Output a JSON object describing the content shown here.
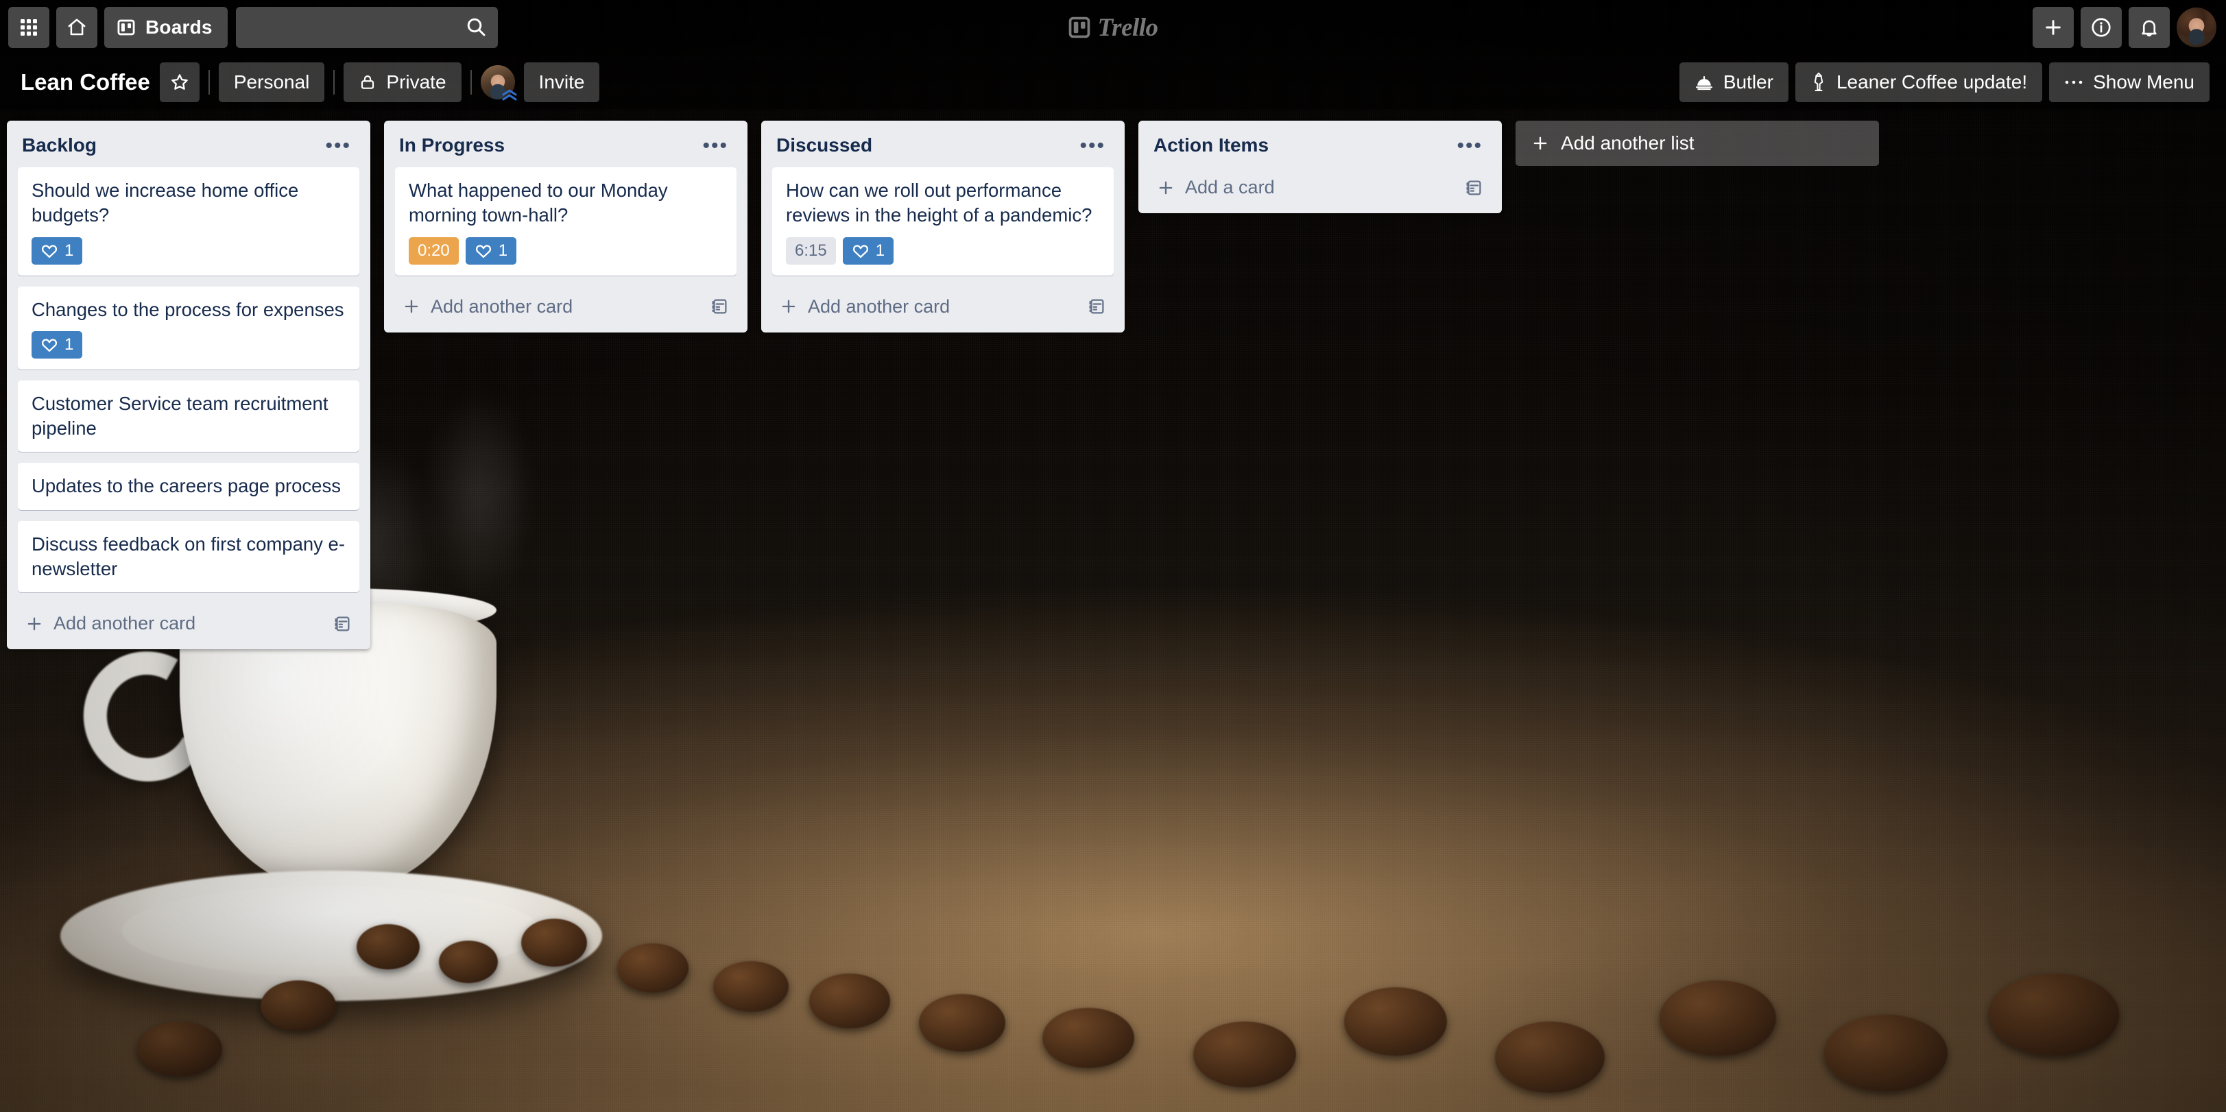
{
  "top_nav": {
    "apps_label": "apps-grid-icon",
    "home_label": "home-icon",
    "boards_label": "Boards",
    "search": {
      "value": "",
      "placeholder": ""
    },
    "logo_text": "Trello",
    "add_label": "+",
    "info_label": "i",
    "notifications_label": "bell",
    "avatar_label": "account-avatar"
  },
  "board_header": {
    "title": "Lean Coffee",
    "star_label": "☆",
    "visibility_team": "Personal",
    "visibility_privacy": "Private",
    "invite_label": "Invite",
    "butler_label": "Butler",
    "power_up_label": "Leaner Coffee update!",
    "show_menu_label": "Show Menu"
  },
  "lists": [
    {
      "title": "Backlog",
      "menu_label": "•••",
      "add_card_label": "Add another card",
      "cards": [
        {
          "title": "Should we increase home office budgets?",
          "badges": [
            {
              "type": "vote",
              "value": "1"
            }
          ]
        },
        {
          "title": "Changes to the process for expenses",
          "badges": [
            {
              "type": "vote",
              "value": "1"
            }
          ]
        },
        {
          "title": "Customer Service team recruitment pipeline",
          "badges": []
        },
        {
          "title": "Updates to the careers page process",
          "badges": []
        },
        {
          "title": "Discuss feedback on first company e-newsletter",
          "badges": []
        }
      ]
    },
    {
      "title": "In Progress",
      "menu_label": "•••",
      "add_card_label": "Add another card",
      "cards": [
        {
          "title": "What happened to our Monday morning town-hall?",
          "badges": [
            {
              "type": "time-active",
              "value": "0:20"
            },
            {
              "type": "vote",
              "value": "1"
            }
          ]
        }
      ]
    },
    {
      "title": "Discussed",
      "menu_label": "•••",
      "add_card_label": "Add another card",
      "cards": [
        {
          "title": "How can we roll out performance reviews in the height of a pandemic?",
          "badges": [
            {
              "type": "time-idle",
              "value": "6:15"
            },
            {
              "type": "vote",
              "value": "1"
            }
          ]
        }
      ]
    },
    {
      "title": "Action Items",
      "menu_label": "•••",
      "add_card_label": "Add a card",
      "cards": []
    }
  ],
  "add_list": {
    "label": "Add another list"
  },
  "colors": {
    "list_bg": "#ebecf0",
    "card_bg": "#ffffff",
    "text_primary": "#172b4d",
    "text_subtle": "#5e6c84",
    "badge_vote": "#3f80c2",
    "badge_time_active": "#eca54c",
    "badge_time_idle": "#e4e6eb"
  }
}
